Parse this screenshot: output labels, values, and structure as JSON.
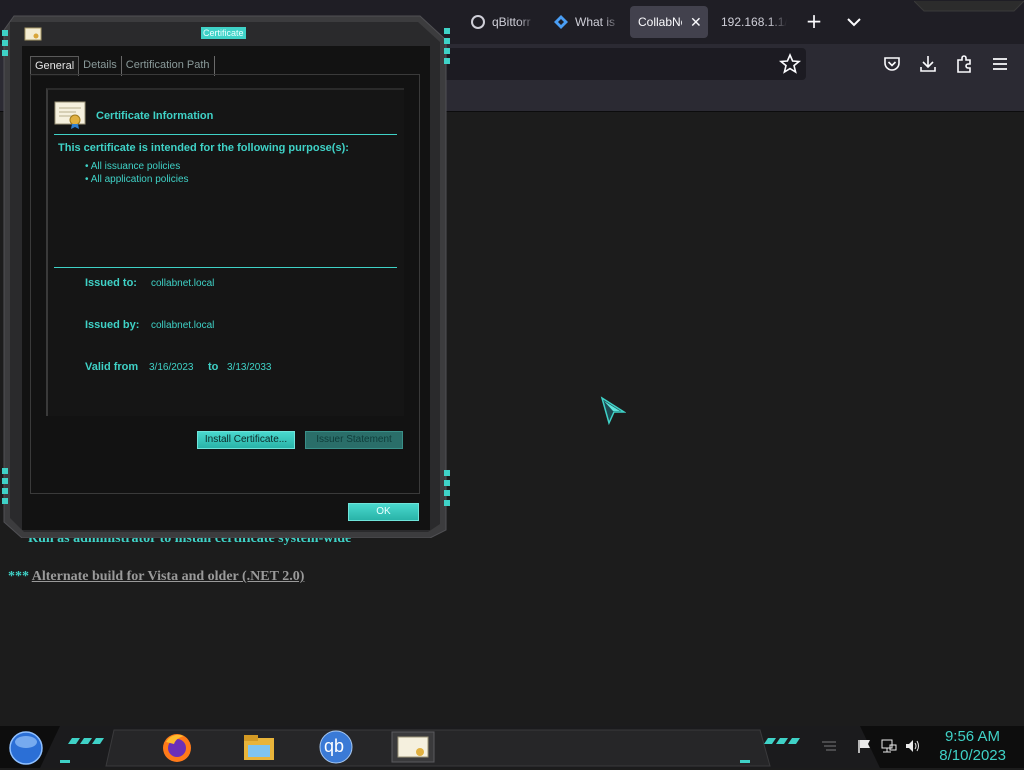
{
  "browser": {
    "tabs": [
      {
        "label": "qBittorr",
        "active": false,
        "icon": "qbittorrent-icon"
      },
      {
        "label": "What is",
        "active": false,
        "icon": "diamond-icon"
      },
      {
        "label": "CollabNe",
        "active": true,
        "icon": "page-icon"
      },
      {
        "label": "192.168.1.1/",
        "active": false,
        "icon": "page-icon"
      }
    ],
    "new_tab": "+",
    "close_glyph": "✕"
  },
  "page": {
    "line1_text": "Run as administrator to install certificate system-wide",
    "line2_prefix": "***",
    "line2_link": "Alternate build for Vista and older (.NET 2.0)"
  },
  "dialog": {
    "title": "Certificate",
    "tabs": [
      "General",
      "Details",
      "Certification Path"
    ],
    "info_title": "Certificate Information",
    "purpose_heading": "This certificate is intended for the following purpose(s):",
    "purposes": [
      "• All issuance policies",
      "• All application policies"
    ],
    "issued_to_label": "Issued to:",
    "issued_to_value": "collabnet.local",
    "issued_by_label": "Issued by:",
    "issued_by_value": "collabnet.local",
    "valid_from_label": "Valid from",
    "valid_from_value": "3/16/2023",
    "valid_to_label": "to",
    "valid_to_value": "3/13/2033",
    "install_button": "Install Certificate...",
    "issuer_button": "Issuer Statement",
    "ok_button": "OK"
  },
  "taskbar": {
    "time": "9:56 AM",
    "date": "8/10/2023",
    "qb_label": "qb"
  },
  "colors": {
    "accent": "#3fd2c7",
    "background": "#1c1c1c"
  }
}
